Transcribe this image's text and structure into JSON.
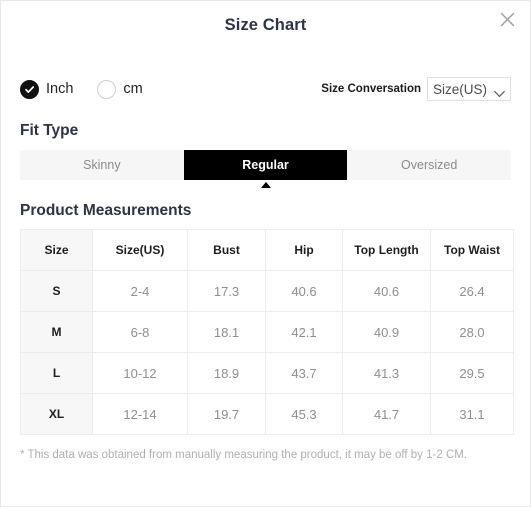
{
  "modal": {
    "title": "Size Chart",
    "close_icon": "close-icon"
  },
  "units": {
    "options": [
      {
        "label": "Inch",
        "selected": true
      },
      {
        "label": "cm",
        "selected": false
      }
    ]
  },
  "conversion": {
    "label": "Size Conversation",
    "selected": "Size(US)",
    "chevron_icon": "chevron-down-icon"
  },
  "fit_type": {
    "heading": "Fit Type",
    "tabs": [
      {
        "label": "Skinny",
        "active": false
      },
      {
        "label": "Regular",
        "active": true
      },
      {
        "label": "Oversized",
        "active": false
      }
    ]
  },
  "measurements": {
    "heading": "Product Measurements",
    "columns": [
      "Size",
      "Size(US)",
      "Bust",
      "Hip",
      "Top Length",
      "Top Waist"
    ],
    "rows": [
      {
        "size": "S",
        "size_us": "2-4",
        "bust": "17.3",
        "hip": "40.6",
        "top_length": "40.6",
        "top_waist": "26.4"
      },
      {
        "size": "M",
        "size_us": "6-8",
        "bust": "18.1",
        "hip": "42.1",
        "top_length": "40.9",
        "top_waist": "28.0"
      },
      {
        "size": "L",
        "size_us": "10-12",
        "bust": "18.9",
        "hip": "43.7",
        "top_length": "41.3",
        "top_waist": "29.5"
      },
      {
        "size": "XL",
        "size_us": "12-14",
        "bust": "19.7",
        "hip": "45.3",
        "top_length": "41.7",
        "top_waist": "31.1"
      }
    ]
  },
  "footnote": "* This data was obtained from manually measuring the product, it may be off by 1-2 CM.",
  "colors": {
    "accent": "#000000",
    "title": "#2c3445",
    "muted": "#8e8e95",
    "border": "#ececec",
    "tab_bg": "#f6f6f6"
  }
}
